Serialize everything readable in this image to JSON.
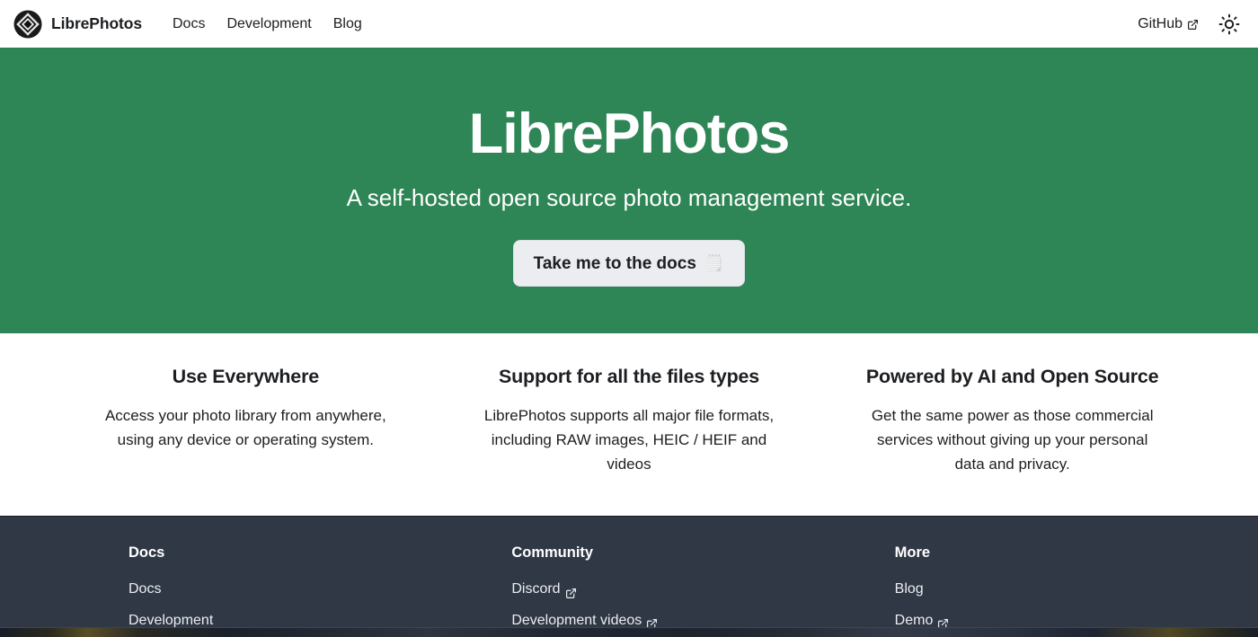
{
  "navbar": {
    "brand": {
      "name": "LibrePhotos",
      "logo_icon": "librephotos-diamond-logo"
    },
    "links": [
      {
        "label": "Docs"
      },
      {
        "label": "Development"
      },
      {
        "label": "Blog"
      }
    ],
    "right": {
      "github_label": "GitHub",
      "github_external_icon": "external-link-icon",
      "theme_toggle_icon": "sun-icon"
    }
  },
  "hero": {
    "title": "LibrePhotos",
    "subtitle": "A self-hosted open source photo management service.",
    "cta_label": "Take me to the docs",
    "cta_emoji": "🗒️",
    "background_color": "#2e8555"
  },
  "features": [
    {
      "title": "Use Everywhere",
      "text": "Access your photo library from anywhere, using any device or operating system."
    },
    {
      "title": "Support for all the files types",
      "text": "LibrePhotos supports all major file formats, including RAW images, HEIC / HEIF and videos"
    },
    {
      "title": "Powered by AI and Open Source",
      "text": "Get the same power as those commercial services without giving up your personal data and privacy."
    }
  ],
  "footer": {
    "background_color": "#303846",
    "columns": [
      {
        "heading": "Docs",
        "items": [
          {
            "label": "Docs",
            "external": false
          },
          {
            "label": "Development",
            "external": false
          }
        ]
      },
      {
        "heading": "Community",
        "items": [
          {
            "label": "Discord",
            "external": true
          },
          {
            "label": "Development videos",
            "external": true
          }
        ]
      },
      {
        "heading": "More",
        "items": [
          {
            "label": "Blog",
            "external": false
          },
          {
            "label": "Demo",
            "external": true
          }
        ]
      }
    ]
  }
}
